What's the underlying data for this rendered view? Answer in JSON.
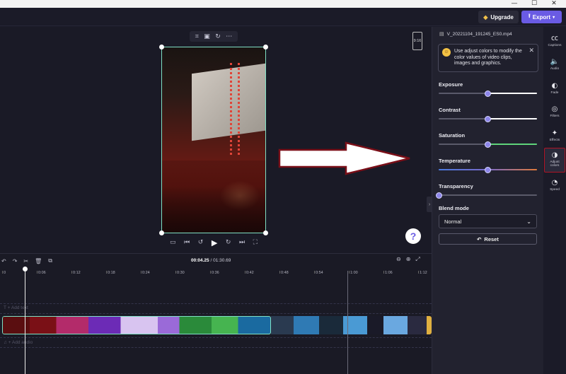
{
  "window": {
    "minimize": "—",
    "maximize": "☐",
    "close": "✕"
  },
  "topbar": {
    "upgrade_label": "Upgrade",
    "export_label": "Export"
  },
  "preview": {
    "aspect_ratio": "9:16",
    "help_label": "?"
  },
  "properties": {
    "file_name": "V_20221104_191245_ES0.mp4",
    "tip_text": "Use adjust colors to modify the color values of video clips, images and graphics.",
    "controls": [
      {
        "label": "Exposure",
        "value": 0.5,
        "color": "#ffffff"
      },
      {
        "label": "Contrast",
        "value": 0.5,
        "color": "#ffffff"
      },
      {
        "label": "Saturation",
        "value": 0.5,
        "color": "#5fd47a"
      },
      {
        "label": "Temperature",
        "value": 0.5,
        "color": "#e07a3a"
      },
      {
        "label": "Transparency",
        "value": 0.0,
        "color": "#ffffff"
      }
    ],
    "blend_mode_label": "Blend mode",
    "blend_mode_value": "Normal",
    "reset_label": "Reset"
  },
  "rail": [
    {
      "icon": "captions-icon",
      "label": "Captions"
    },
    {
      "icon": "audio-icon",
      "label": "Audio"
    },
    {
      "icon": "fade-icon",
      "label": "Fade"
    },
    {
      "icon": "filters-icon",
      "label": "Filters"
    },
    {
      "icon": "effects-icon",
      "label": "Effects"
    },
    {
      "icon": "adjust-colors-icon",
      "label": "Adjust colors",
      "active": true
    },
    {
      "icon": "speed-icon",
      "label": "Speed"
    }
  ],
  "timeline": {
    "current_time": "00:04.25",
    "total_time": "/ 01:30.69",
    "ticks": [
      "0",
      "0:06",
      "0:12",
      "0:18",
      "0:24",
      "0:30",
      "0:36",
      "0:42",
      "0:48",
      "0:54",
      "1:00",
      "1:06",
      "1:12"
    ],
    "add_text_label": "+ Add text",
    "add_audio_label": "+ Add audio"
  },
  "colors": {
    "accent": "#6a5be4",
    "highlight": "#b01426",
    "selection": "#7fe0c4"
  }
}
